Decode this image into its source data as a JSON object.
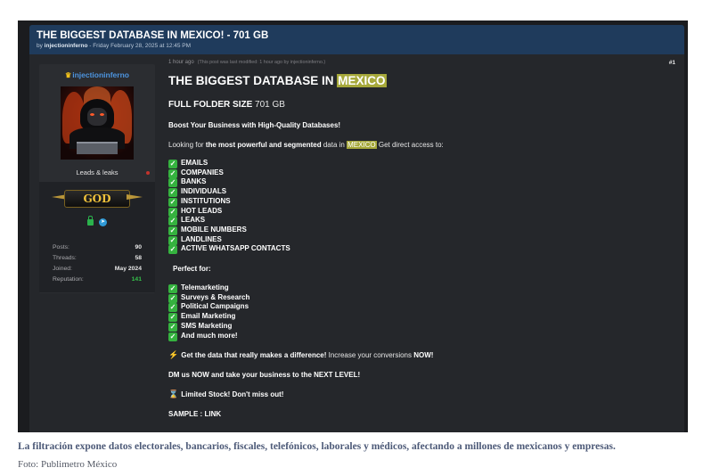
{
  "thread": {
    "title": "THE BIGGEST DATABASE IN MEXICO! - 701 GB",
    "meta_prefix": "by ",
    "author": "injectioninferno",
    "meta_sep": " - ",
    "date": "Friday February 28, 2025 at 12:45 PM"
  },
  "profile": {
    "username": "injectioninferno",
    "crown_icon": "♛",
    "rank": "Leads & leaks",
    "badge": "GOD",
    "stats": [
      {
        "label": "Posts:",
        "value": "90"
      },
      {
        "label": "Threads:",
        "value": "58"
      },
      {
        "label": "Joined:",
        "value": "May 2024"
      },
      {
        "label": "Reputation:",
        "value": "141"
      }
    ],
    "reputation_color": "#35c04a"
  },
  "post": {
    "time": "1 hour ago",
    "modified": "(This post was last modified: 1 hour ago by injectioninferno.)",
    "number": "#1",
    "heading_prefix": "THE BIGGEST DATABASE IN ",
    "heading_highlight": "MEXICO",
    "size_label": "FULL FOLDER SIZE",
    "size_value": "701 GB",
    "boost": "Boost Your Business with High-Quality Databases!",
    "intro_a": "Looking for ",
    "intro_bold": "the most powerful and segmented",
    "intro_b": " data in ",
    "intro_highlight": "MEXICO",
    "intro_c": " Get direct access to:",
    "data_items": [
      "EMAILS",
      "COMPANIES",
      "BANKS",
      "INDIVIDUALS",
      "INSTITUTIONS",
      "HOT LEADS",
      "LEAKS",
      "MOBILE NUMBERS",
      "LANDLINES",
      "ACTIVE WHATSAPP CONTACTS"
    ],
    "perfect_for": "Perfect for:",
    "uses": [
      "Telemarketing",
      "Surveys & Research",
      "Political Campaigns",
      "Email Marketing",
      "SMS Marketing",
      "And much more!"
    ],
    "cta_bold": "Get the data that really makes a difference!",
    "cta_mid": " Increase your conversions ",
    "cta_now": "NOW!",
    "dm": "DM us NOW and take your business to the NEXT LEVEL!",
    "stock": "Limited Stock! Don't miss out!",
    "sample_label": "SAMPLE : ",
    "sample_link": "LINK",
    "highlight_color": "#a6a83a"
  },
  "caption": "La filtración expone datos electorales, bancarios, fiscales, telefónicos, laborales y médicos, afectando a millones de mexicanos y empresas.",
  "credit": "Foto: Publimetro México"
}
